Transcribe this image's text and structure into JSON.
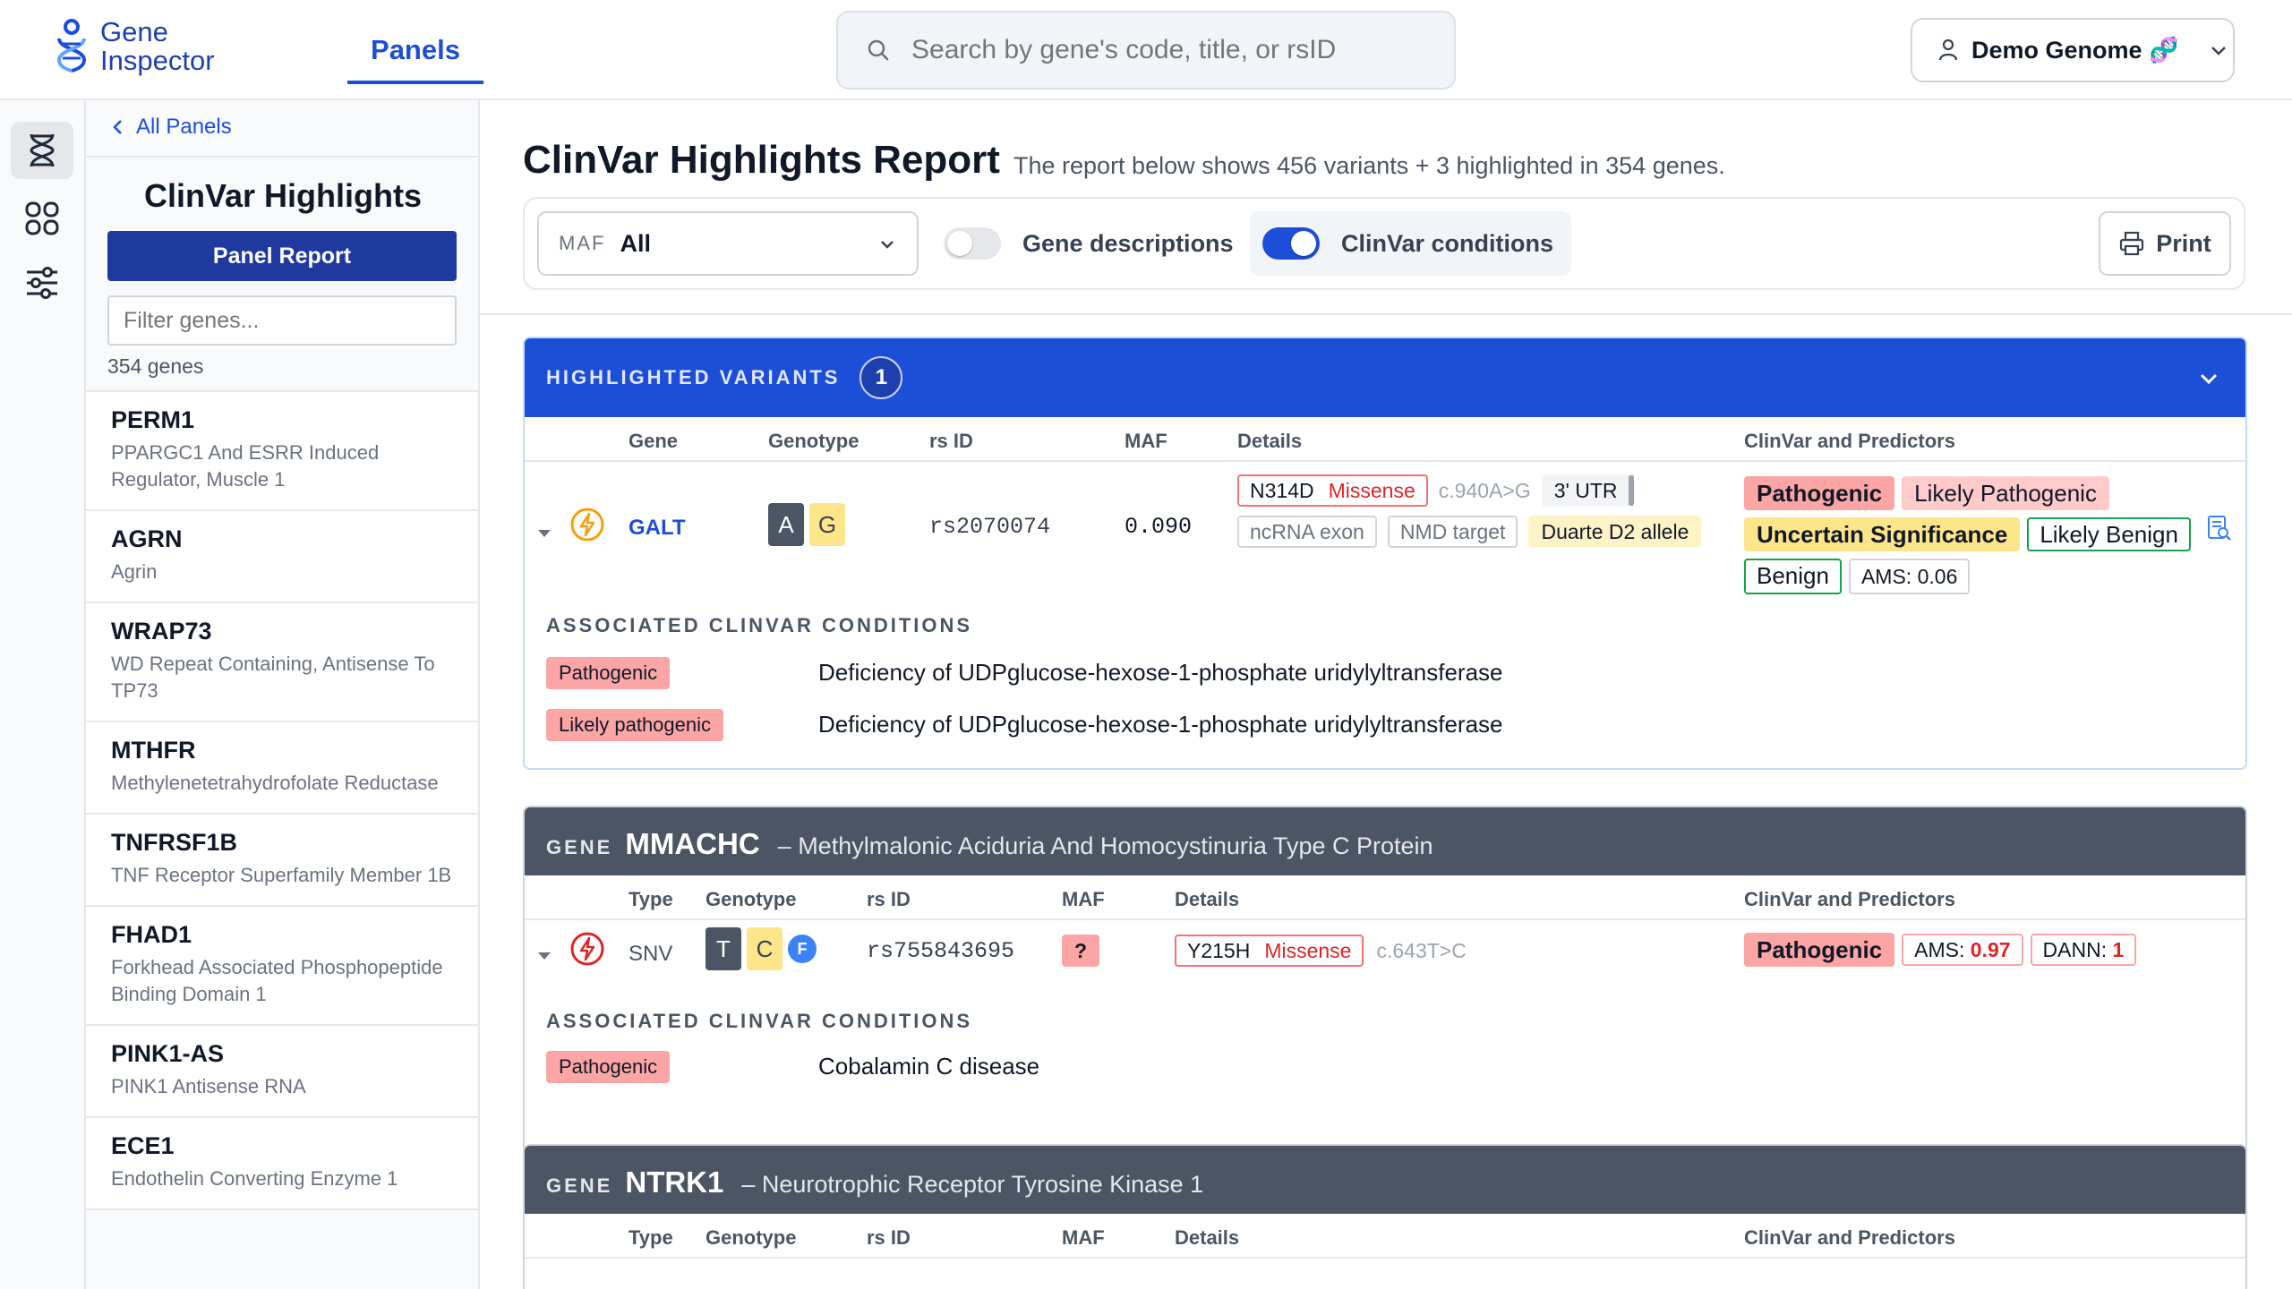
{
  "app": {
    "logo_line1": "Gene",
    "logo_line2": "Inspector",
    "nav_tab": "Panels"
  },
  "search": {
    "placeholder": "Search by gene's code, title, or rsID"
  },
  "user": {
    "label": "Demo Genome 🧬"
  },
  "sidebar": {
    "back_label": "All Panels",
    "panel_title": "ClinVar Highlights",
    "panel_report_label": "Panel Report",
    "filter_placeholder": "Filter genes...",
    "gene_count": "354 genes",
    "genes": [
      {
        "symbol": "PERM1",
        "name": "PPARGC1 And ESRR Induced Regulator, Muscle 1"
      },
      {
        "symbol": "AGRN",
        "name": "Agrin"
      },
      {
        "symbol": "WRAP73",
        "name": "WD Repeat Containing, Antisense To TP73"
      },
      {
        "symbol": "MTHFR",
        "name": "Methylenetetrahydrofolate Reductase"
      },
      {
        "symbol": "TNFRSF1B",
        "name": "TNF Receptor Superfamily Member 1B"
      },
      {
        "symbol": "FHAD1",
        "name": "Forkhead Associated Phosphopeptide Binding Domain 1"
      },
      {
        "symbol": "PINK1-AS",
        "name": "PINK1 Antisense RNA"
      },
      {
        "symbol": "ECE1",
        "name": "Endothelin Converting Enzyme 1"
      }
    ]
  },
  "report": {
    "title": "ClinVar Highlights Report",
    "subtitle": "The report below shows 456 variants + 3 highlighted in 354 genes.",
    "maf_label": "MAF",
    "maf_value": "All",
    "toggle_gene_desc": "Gene descriptions",
    "toggle_clinvar": "ClinVar conditions",
    "print_label": "Print"
  },
  "highlighted": {
    "title": "HIGHLIGHTED VARIANTS",
    "count": "1",
    "columns": {
      "gene": "Gene",
      "genotype": "Genotype",
      "rsid": "rs ID",
      "maf": "MAF",
      "details": "Details",
      "clinvar": "ClinVar and Predictors"
    },
    "variant": {
      "gene": "GALT",
      "allele1": "A",
      "allele2": "G",
      "rsid": "rs2070074",
      "maf": "0.090",
      "protein_change": "N314D",
      "consequence": "Missense",
      "hgvs": "c.940A>G",
      "region": "3' UTR",
      "tag_ncrna": "ncRNA exon",
      "tag_nmd": "NMD target",
      "tag_allele_name": "Duarte D2 allele",
      "clin_pathogenic": "Pathogenic",
      "clin_likely_pathogenic": "Likely Pathogenic",
      "clin_uncertain": "Uncertain Significance",
      "clin_likely_benign": "Likely Benign",
      "clin_benign": "Benign",
      "ams": "AMS: 0.06"
    },
    "conditions_title": "ASSOCIATED CLINVAR CONDITIONS",
    "conditions": [
      {
        "significance": "Pathogenic",
        "name": "Deficiency of UDPglucose-hexose-1-phosphate uridylyltransferase"
      },
      {
        "significance": "Likely pathogenic",
        "name": "Deficiency of UDPglucose-hexose-1-phosphate uridylyltransferase"
      }
    ]
  },
  "gene_mmachc": {
    "keyword": "GENE",
    "symbol": "MMACHC",
    "name": "– Methylmalonic Aciduria And Homocystinuria Type C Protein",
    "columns": {
      "type": "Type",
      "genotype": "Genotype",
      "rsid": "rs ID",
      "maf": "MAF",
      "details": "Details",
      "clinvar": "ClinVar and Predictors"
    },
    "variant": {
      "type": "SNV",
      "allele1": "T",
      "allele2": "C",
      "flag": "F",
      "rsid": "rs755843695",
      "maf": "?",
      "protein_change": "Y215H",
      "consequence": "Missense",
      "hgvs": "c.643T>C",
      "clin": "Pathogenic",
      "ams_label": "AMS:",
      "ams_value": "0.97",
      "dann_label": "DANN:",
      "dann_value": "1"
    },
    "conditions_title": "ASSOCIATED CLINVAR CONDITIONS",
    "conditions": [
      {
        "significance": "Pathogenic",
        "name": "Cobalamin C disease"
      }
    ]
  },
  "gene_ntrk1": {
    "keyword": "GENE",
    "symbol": "NTRK1",
    "name": "– Neurotrophic Receptor Tyrosine Kinase 1",
    "columns": {
      "type": "Type",
      "genotype": "Genotype",
      "rsid": "rs ID",
      "maf": "MAF",
      "details": "Details",
      "clinvar": "ClinVar and Predictors"
    }
  },
  "colors": {
    "accent": "#1d4ed8",
    "gene_header": "#4b5563",
    "pathogenic": "#fca5a5",
    "uncertain": "#fde68a",
    "benign_border": "#16a34a"
  }
}
